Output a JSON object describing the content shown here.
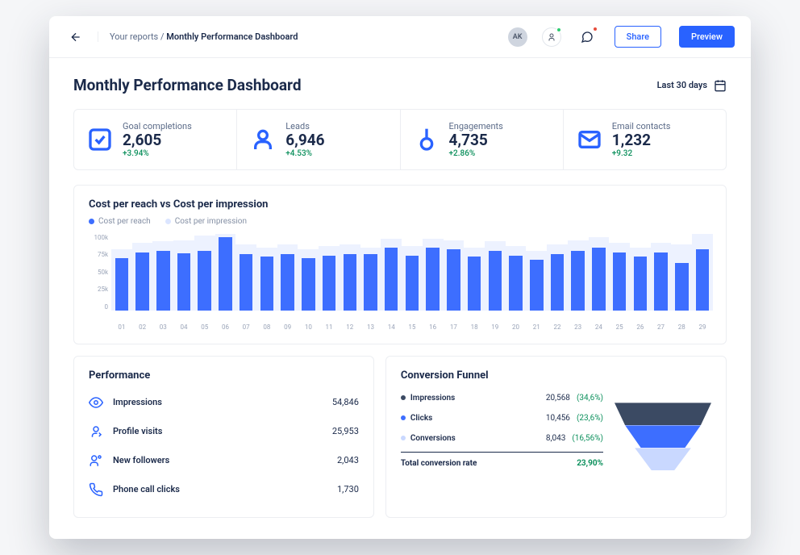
{
  "breadcrumb": {
    "root": "Your reports",
    "current": "Monthly Performance Dashboard"
  },
  "avatars": {
    "a1": "AK",
    "a2_dot": "#2ecc71",
    "chat_dot": "#e74c3c"
  },
  "buttons": {
    "share": "Share",
    "preview": "Preview"
  },
  "title": "Monthly Performance Dashboard",
  "date_range": "Last 30 days",
  "kpis": [
    {
      "icon": "check",
      "label": "Goal completions",
      "value": "2,605",
      "change": "+3.94%"
    },
    {
      "icon": "person",
      "label": "Leads",
      "value": "6,946",
      "change": "+4.53%"
    },
    {
      "icon": "touch",
      "label": "Engagements",
      "value": "4,735",
      "change": "+2.86%"
    },
    {
      "icon": "mail",
      "label": "Email contacts",
      "value": "1,232",
      "change": "+9.32"
    }
  ],
  "chart": {
    "title": "Cost per reach vs Cost per impression",
    "legend": [
      {
        "label": "Cost per reach",
        "color": "#3d6eff"
      },
      {
        "label": "Cost per impression",
        "color": "#dbe5ff"
      }
    ],
    "yticks": [
      "100k",
      "75k",
      "50k",
      "25k",
      "0"
    ]
  },
  "chart_data": {
    "type": "bar",
    "title": "Cost per reach vs Cost per impression",
    "ylabel": "",
    "xlabel": "",
    "ylim": [
      0,
      100000
    ],
    "categories": [
      "01",
      "02",
      "03",
      "04",
      "05",
      "06",
      "07",
      "08",
      "09",
      "10",
      "11",
      "12",
      "13",
      "14",
      "15",
      "16",
      "17",
      "18",
      "19",
      "20",
      "21",
      "22",
      "23",
      "24",
      "25",
      "26",
      "27",
      "28",
      "29"
    ],
    "series": [
      {
        "name": "Cost per reach",
        "color": "#3d6eff",
        "values": [
          68000,
          76000,
          78000,
          75000,
          78000,
          96000,
          74000,
          70000,
          74000,
          68000,
          72000,
          74000,
          74000,
          82000,
          72000,
          82000,
          80000,
          70000,
          78000,
          72000,
          66000,
          74000,
          78000,
          82000,
          76000,
          70000,
          76000,
          62000,
          80000
        ]
      },
      {
        "name": "Cost per impression",
        "color": "#dbe5ff",
        "values": [
          80000,
          88000,
          90000,
          92000,
          98000,
          100000,
          86000,
          82000,
          86000,
          80000,
          84000,
          86000,
          82000,
          94000,
          84000,
          94000,
          92000,
          82000,
          90000,
          84000,
          78000,
          86000,
          92000,
          96000,
          88000,
          82000,
          88000,
          86000,
          100000
        ]
      }
    ]
  },
  "performance": {
    "title": "Performance",
    "rows": [
      {
        "icon": "eye",
        "label": "Impressions",
        "value": "54,846"
      },
      {
        "icon": "visit",
        "label": "Profile visits",
        "value": "25,953"
      },
      {
        "icon": "follow",
        "label": "New followers",
        "value": "2,043"
      },
      {
        "icon": "phone",
        "label": "Phone call clicks",
        "value": "1,730"
      }
    ]
  },
  "funnel": {
    "title": "Conversion Funnel",
    "rows": [
      {
        "label": "Impressions",
        "value": "20,568",
        "pct": "(34,6%)",
        "color": "#3b4a63"
      },
      {
        "label": "Clicks",
        "value": "10,456",
        "pct": "(23,6%)",
        "color": "#3d6eff"
      },
      {
        "label": "Conversions",
        "value": "8,043",
        "pct": "(16,56%)",
        "color": "#c9d8ff"
      }
    ],
    "total_label": "Total conversion rate",
    "total_value": "23,90%"
  }
}
